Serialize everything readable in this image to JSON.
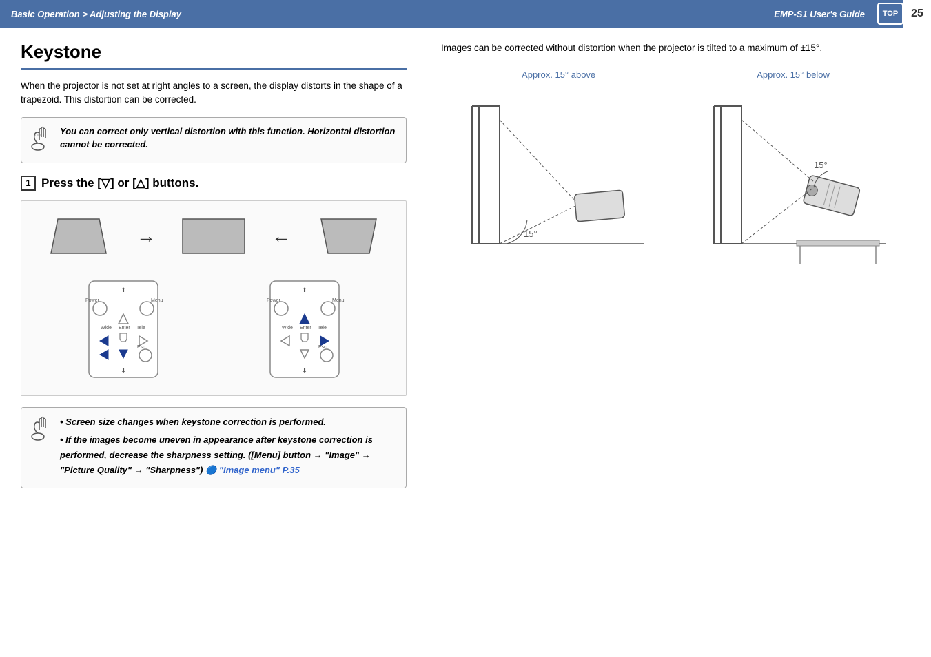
{
  "header": {
    "breadcrumb": "Basic Operation > Adjusting the Display",
    "guide_title": "EMP-S1 User's Guide",
    "top_label": "TOP",
    "page_number": "25"
  },
  "main": {
    "title": "Keystone",
    "intro": "When the projector is not set at right angles to a screen, the display distorts in the shape of a trapezoid. This distortion can be corrected.",
    "note1": {
      "icon": "🖐",
      "text": "You can correct only vertical distortion with this function. Horizontal distortion cannot be corrected."
    },
    "step1": {
      "number": "1",
      "text": "Press the [▽] or [△] buttons."
    },
    "note2": {
      "icon": "🖐",
      "bullets": [
        "Screen size changes when keystone correction is performed.",
        "If the images become uneven in appearance after keystone correction is performed, decrease the sharpness setting. ([Menu] button → \"Image\" → \"Picture Quality\" → \"Sharpness\")"
      ],
      "link_text": "\"Image menu\" P.35"
    }
  },
  "right": {
    "intro": "Images can be corrected without distortion when the projector is tilted to a maximum of ±15°.",
    "label_above": "Approx. 15° above",
    "label_below": "Approx. 15° below",
    "angle_value": "15°"
  }
}
